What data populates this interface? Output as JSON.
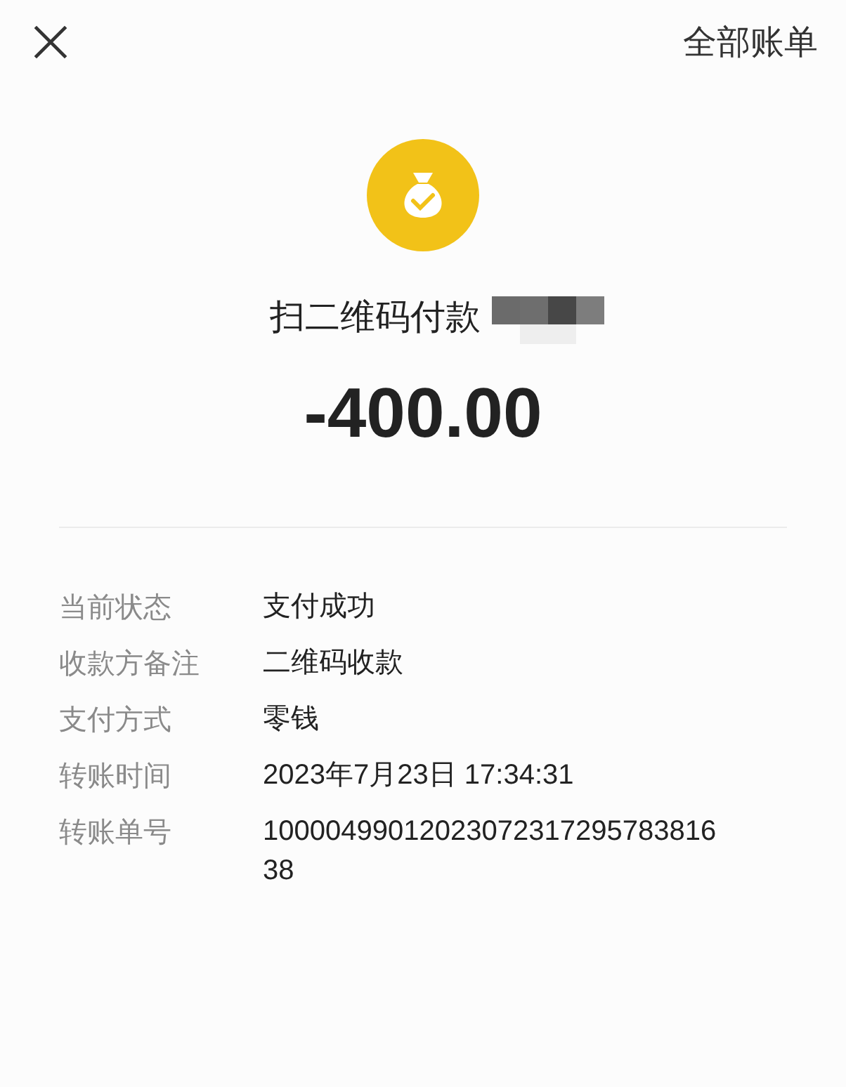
{
  "header": {
    "action": "全部账单"
  },
  "payment": {
    "title": "扫二维码付款",
    "amount": "-400.00"
  },
  "details": [
    {
      "label": "当前状态",
      "value": "支付成功"
    },
    {
      "label": "收款方备注",
      "value": "二维码收款"
    },
    {
      "label": "支付方式",
      "value": "零钱"
    },
    {
      "label": "转账时间",
      "value": "2023年7月23日 17:34:31"
    },
    {
      "label": "转账单号",
      "value": "1000049901202307231729578381638"
    }
  ]
}
